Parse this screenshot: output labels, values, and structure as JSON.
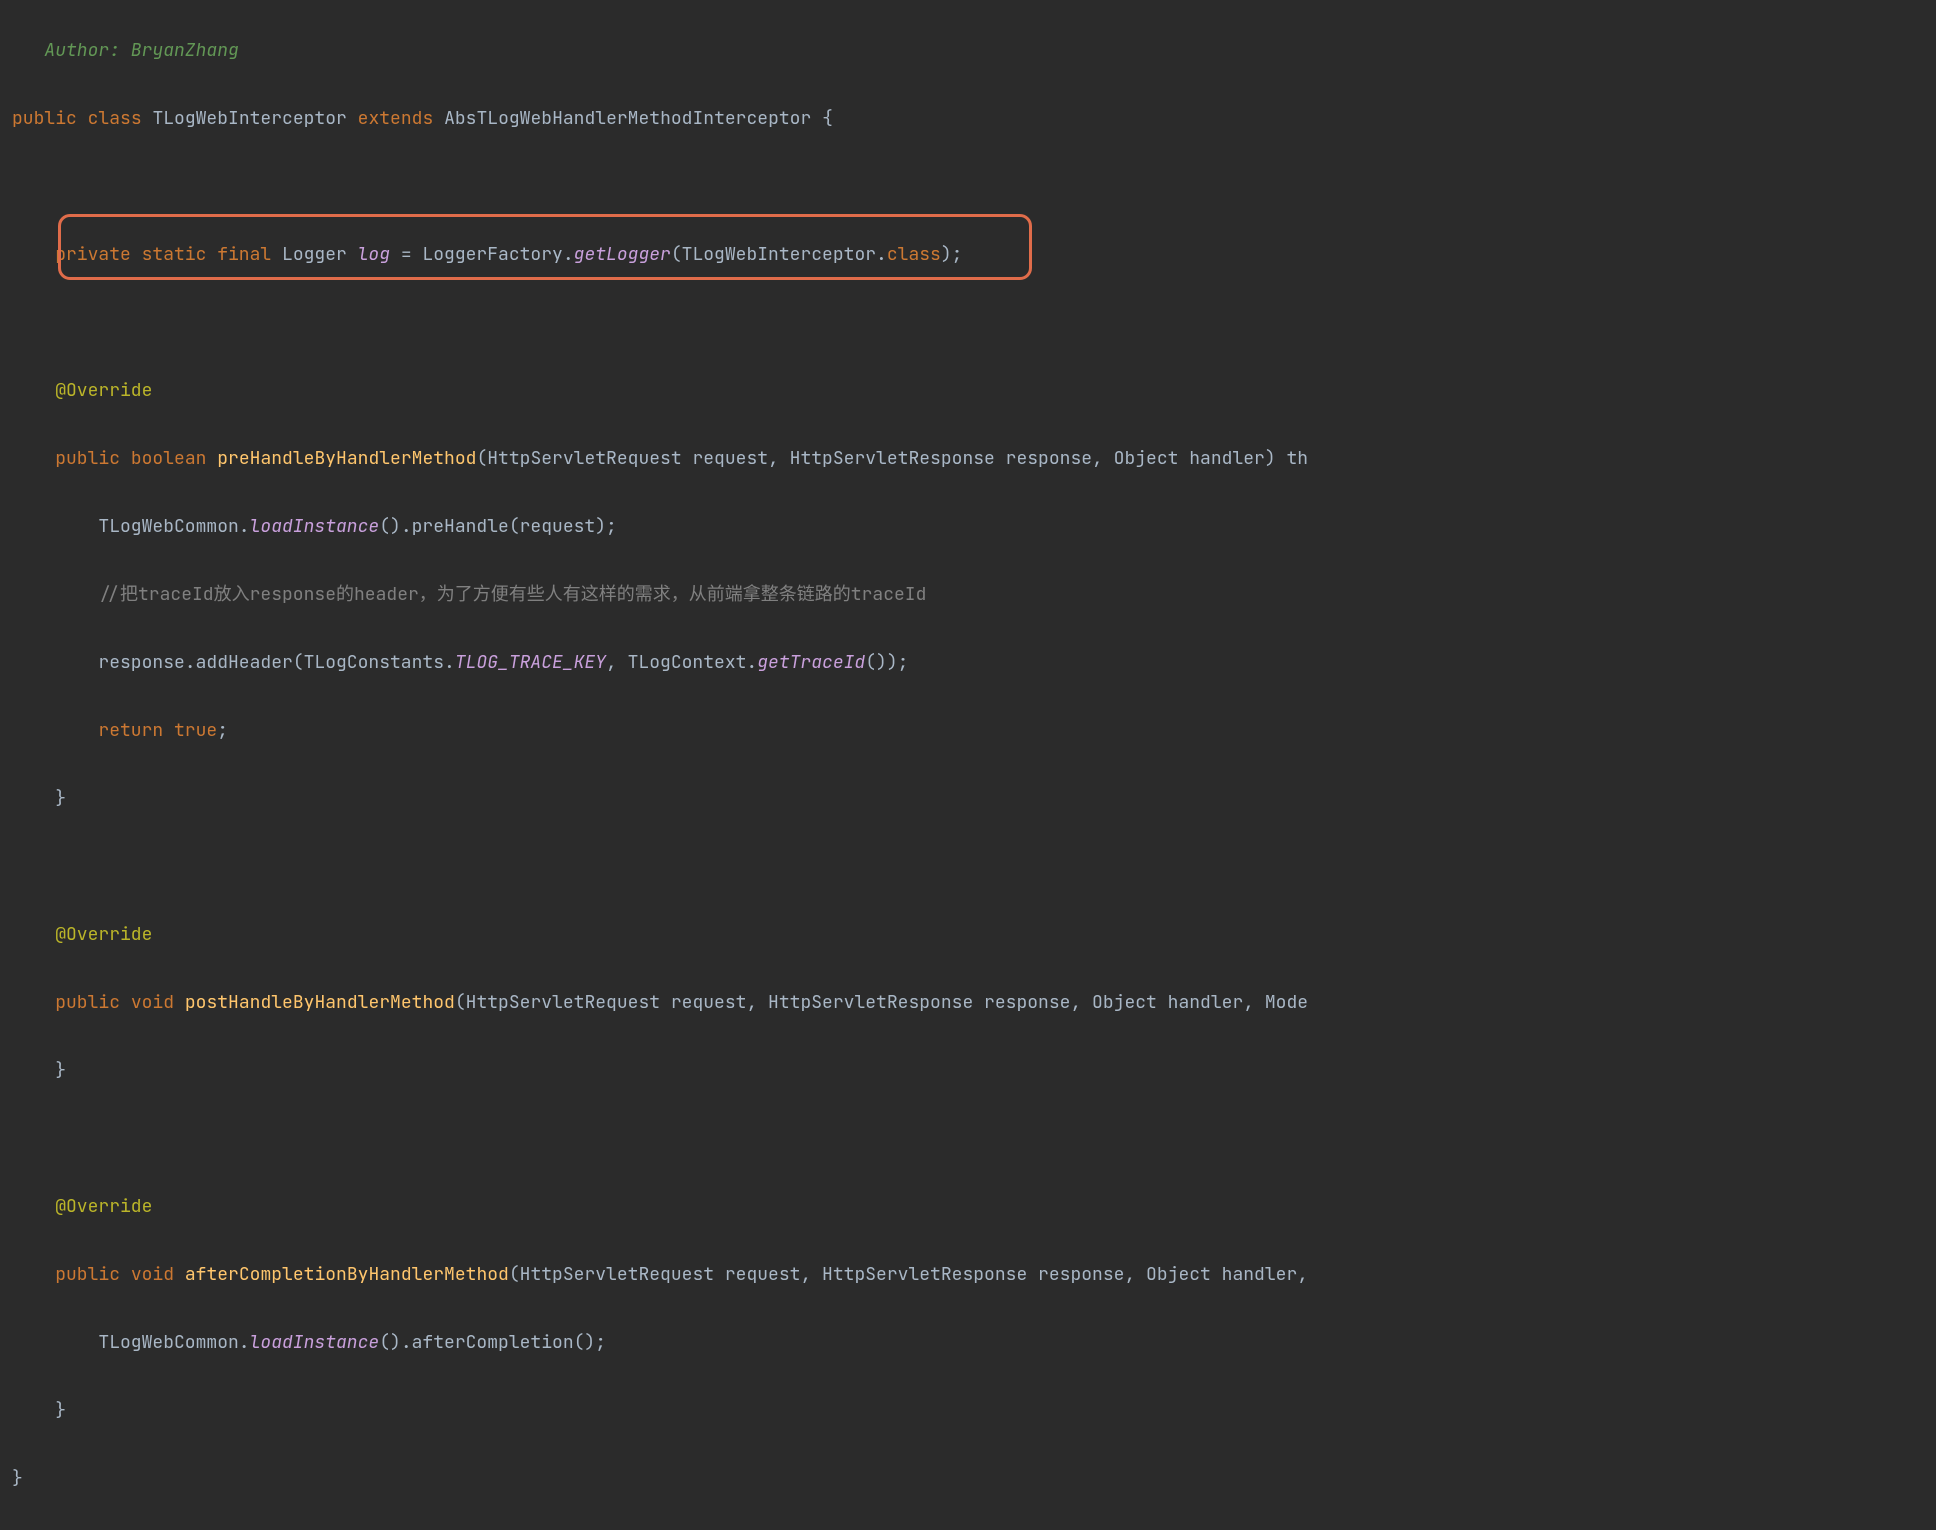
{
  "code": {
    "authorComment": "   Author: BryanZhang",
    "classDecl": {
      "prefix1": "public",
      "prefix2": "class",
      "name": "TLogWebInterceptor",
      "ext": "extends",
      "superName": "AbsTLogWebHandlerMethodInterceptor",
      "brace": " {"
    },
    "logger": {
      "kw1": "private static final ",
      "type": "Logger ",
      "var": "log",
      "assign": " = LoggerFactory.",
      "getLogger": "getLogger",
      "tail": "(TLogWebInterceptor.",
      "cls": "class",
      "end": ");"
    },
    "override": "@Override",
    "preHandle": {
      "pub": "public",
      "bool": "boolean",
      "name": "preHandleByHandlerMethod",
      "sigTail": "(HttpServletRequest request, HttpServletResponse response, Object handler) th",
      "line1a": "TLogWebCommon.",
      "line1b": "loadInstance",
      "line1c": "().preHandle(request);",
      "commentChinese": "//把traceId放入response的header，为了方便有些人有这样的需求，从前端拿整条链路的traceId",
      "line3a": "response.addHeader(TLogConstants.",
      "line3b": "TLOG_TRACE_KEY",
      "line3c": ", TLogContext.",
      "line3d": "getTraceId",
      "line3e": "());",
      "ret": "return true",
      "semi": ";"
    },
    "postHandle": {
      "pub": "public",
      "void": "void",
      "name": "postHandleByHandlerMethod",
      "sigTail": "(HttpServletRequest request, HttpServletResponse response, Object handler, Mode"
    },
    "afterCompletion": {
      "pub": "public",
      "void": "void",
      "name": "afterCompletionByHandlerMethod",
      "sigTail": "(HttpServletRequest request, HttpServletResponse response, Object handler,",
      "line1a": "TLogWebCommon.",
      "line1b": "loadInstance",
      "line1c": "().afterCompletion();"
    },
    "closeBrace": "}",
    "closeBraceInd": "    }"
  }
}
